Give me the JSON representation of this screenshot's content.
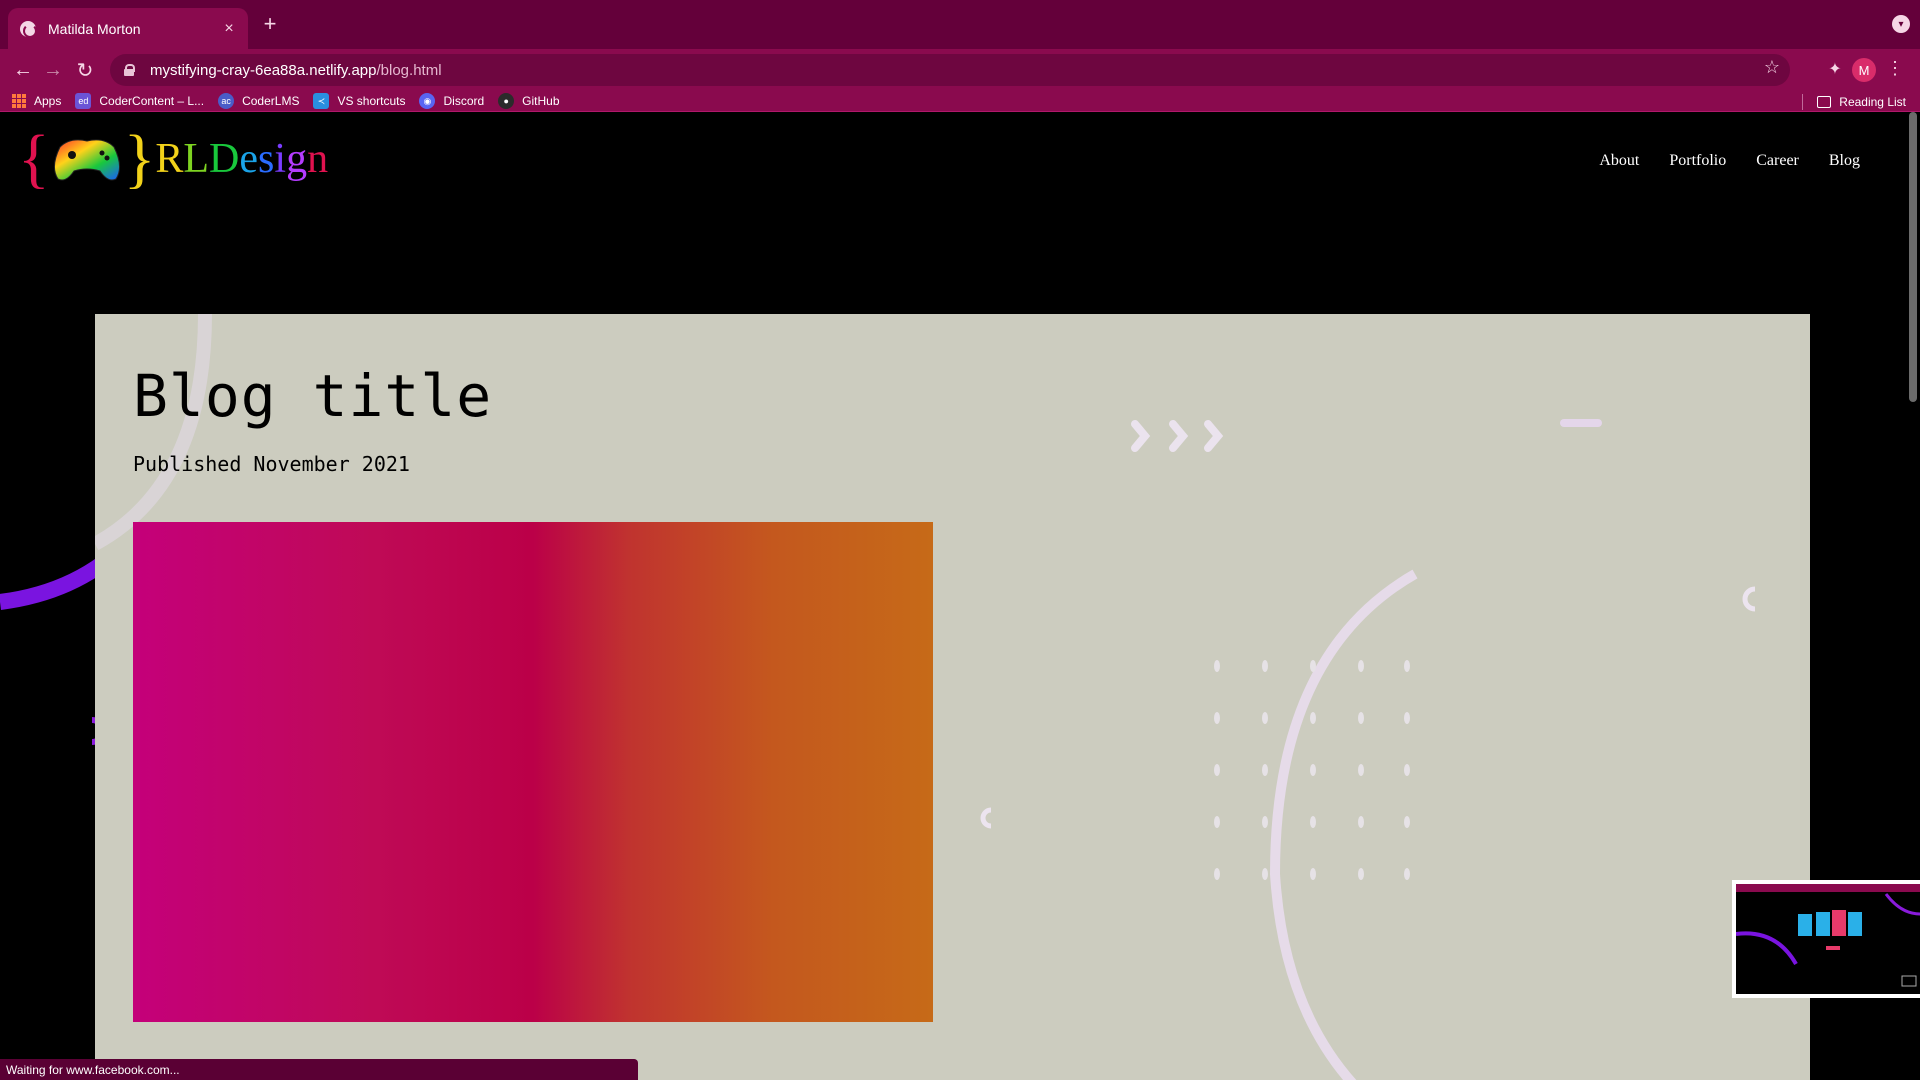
{
  "browser": {
    "tab_title": "Matilda Morton",
    "url_host": "mystifying-cray-6ea88a.netlify.app",
    "url_path": "/blog.html",
    "profile_initial": "M"
  },
  "bookmarks": [
    {
      "label": "Apps",
      "icon": "apps-grid-icon"
    },
    {
      "label": "CoderContent – L...",
      "icon": "ed-icon"
    },
    {
      "label": "CoderLMS",
      "icon": "coderlms-icon"
    },
    {
      "label": "VS shortcuts",
      "icon": "vscode-icon"
    },
    {
      "label": "Discord",
      "icon": "discord-icon"
    },
    {
      "label": "GitHub",
      "icon": "github-icon"
    }
  ],
  "reading_list_label": "Reading List",
  "site": {
    "logo": {
      "open": "{",
      "close": "}",
      "word": "RLDesign"
    },
    "nav": [
      "About",
      "Portfolio",
      "Career",
      "Blog"
    ]
  },
  "post": {
    "title": "Blog title",
    "published": "Published November 2021"
  },
  "status_text": "Waiting for www.facebook.com...",
  "colors": {
    "chrome_dark": "#64003a",
    "chrome": "#8a0a4e",
    "card_bg": "#ccccbf",
    "accent_purple": "#8a1bdc"
  }
}
